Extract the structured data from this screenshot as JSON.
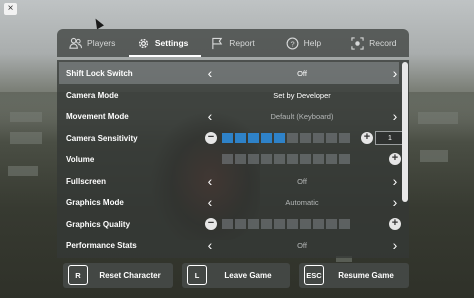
{
  "window": {
    "close_glyph": "×"
  },
  "tabs": [
    {
      "label": "Players",
      "icon": "players-icon",
      "active": false
    },
    {
      "label": "Settings",
      "icon": "gear-icon",
      "active": true
    },
    {
      "label": "Report",
      "icon": "flag-icon",
      "active": false
    },
    {
      "label": "Help",
      "icon": "help-icon",
      "active": false
    },
    {
      "label": "Record",
      "icon": "record-icon",
      "active": false
    }
  ],
  "settings": {
    "shift_lock": {
      "label": "Shift Lock Switch",
      "value": "Off"
    },
    "camera_mode": {
      "label": "Camera Mode",
      "value": "Set by Developer"
    },
    "movement_mode": {
      "label": "Movement Mode",
      "value": "Default (Keyboard)"
    },
    "camera_sensitivity": {
      "label": "Camera Sensitivity",
      "value": "1",
      "filled_segments": 5,
      "total_segments": 10
    },
    "volume": {
      "label": "Volume",
      "filled_segments": 0,
      "total_segments": 10
    },
    "fullscreen": {
      "label": "Fullscreen",
      "value": "Off"
    },
    "graphics_mode": {
      "label": "Graphics Mode",
      "value": "Automatic"
    },
    "graphics_quality": {
      "label": "Graphics Quality",
      "filled_segments": 0,
      "total_segments": 10
    },
    "performance_stats": {
      "label": "Performance Stats",
      "value": "Off"
    }
  },
  "bottom": {
    "reset": {
      "key": "R",
      "label": "Reset Character"
    },
    "leave": {
      "key": "L",
      "label": "Leave Game"
    },
    "resume": {
      "key": "ESC",
      "label": "Resume Game"
    }
  },
  "colors": {
    "accent": "#2e82c8",
    "highlight_row": "#8c9194",
    "panel": "#343836"
  }
}
